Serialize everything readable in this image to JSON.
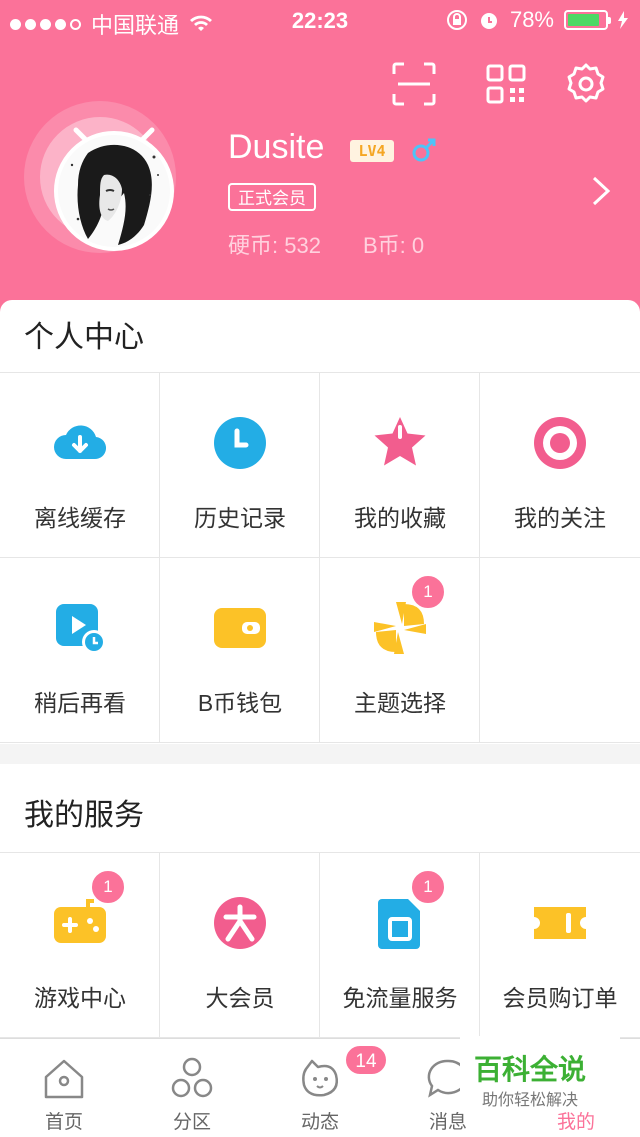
{
  "status_bar": {
    "carrier": "中国联通",
    "time": "22:23",
    "battery": "78%",
    "battery_level": 0.78
  },
  "header": {
    "username": "Dusite",
    "level": "LV4",
    "member_badge": "正式会员",
    "coins_label": "硬币: 532",
    "bcoin_label": "B币: 0"
  },
  "personal_center": {
    "title": "个人中心",
    "items": [
      {
        "label": "离线缓存",
        "icon": "cloud-download-icon",
        "badge": ""
      },
      {
        "label": "历史记录",
        "icon": "clock-icon",
        "badge": ""
      },
      {
        "label": "我的收藏",
        "icon": "star-icon",
        "badge": ""
      },
      {
        "label": "我的关注",
        "icon": "target-icon",
        "badge": ""
      },
      {
        "label": "稍后再看",
        "icon": "watch-later-icon",
        "badge": ""
      },
      {
        "label": "B币钱包",
        "icon": "wallet-icon",
        "badge": ""
      },
      {
        "label": "主题选择",
        "icon": "theme-icon",
        "badge": "1"
      }
    ]
  },
  "my_services": {
    "title": "我的服务",
    "items": [
      {
        "label": "游戏中心",
        "icon": "gamepad-icon",
        "badge": "1"
      },
      {
        "label": "大会员",
        "icon": "vip-icon",
        "badge": ""
      },
      {
        "label": "免流量服务",
        "icon": "sim-card-icon",
        "badge": "1"
      },
      {
        "label": "会员购订单",
        "icon": "ticket-icon",
        "badge": ""
      }
    ]
  },
  "tab_bar": {
    "tabs": [
      {
        "label": "首页",
        "icon": "home-icon"
      },
      {
        "label": "分区",
        "icon": "category-icon"
      },
      {
        "label": "动态",
        "icon": "feed-icon"
      },
      {
        "label": "消息",
        "icon": "message-icon"
      },
      {
        "label": "我的",
        "icon": "profile-icon"
      }
    ],
    "feed_badge": "14",
    "active_tab": "我的"
  },
  "watermark": {
    "title": "百科全说",
    "subtitle": "助你轻松解决"
  },
  "colors": {
    "brand_pink": "#fb7299",
    "blue": "#23ade5",
    "yellow": "#fcc227"
  }
}
